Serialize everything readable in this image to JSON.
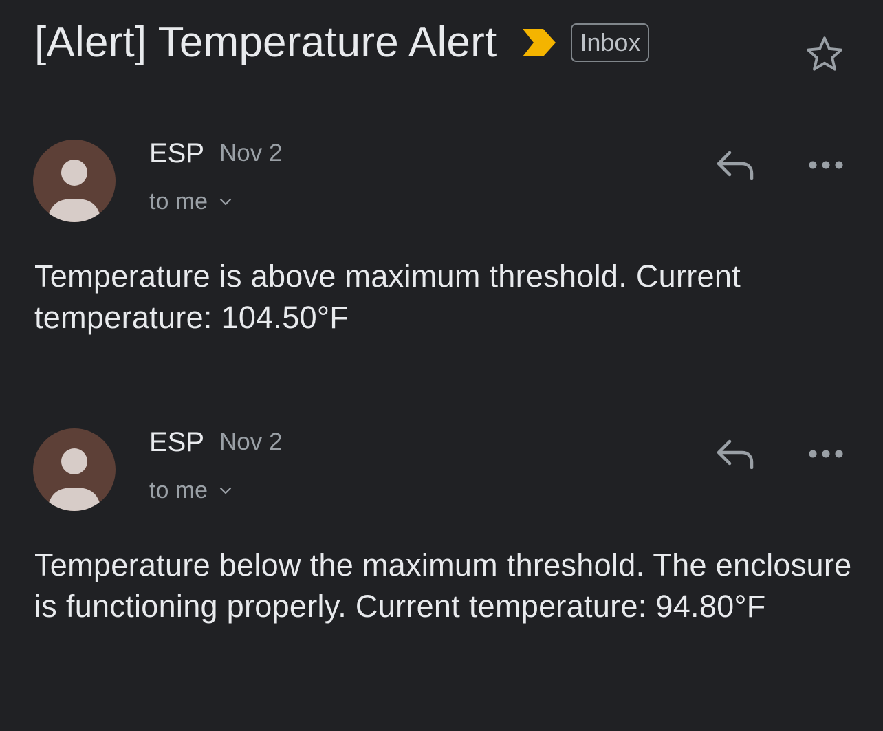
{
  "thread": {
    "subject": "[Alert] Temperature Alert",
    "label": "Inbox",
    "importance_color": "#f4b400",
    "star_icon": "star-outline-icon"
  },
  "messages": [
    {
      "sender": "ESP",
      "date": "Nov 2",
      "recipient": "to me",
      "body": "Temperature is above maximum threshold. Current temperature: 104.50°F",
      "avatar_color": "#5d4037"
    },
    {
      "sender": "ESP",
      "date": "Nov 2",
      "recipient": "to me",
      "body": "Temperature below the maximum threshold. The enclosure is functioning properly. Current temperature: 94.80°F",
      "avatar_color": "#5d4037"
    }
  ],
  "colors": {
    "background": "#202124",
    "text_primary": "#e8eaed",
    "text_secondary": "#9aa0a6",
    "divider": "#5f6368"
  }
}
